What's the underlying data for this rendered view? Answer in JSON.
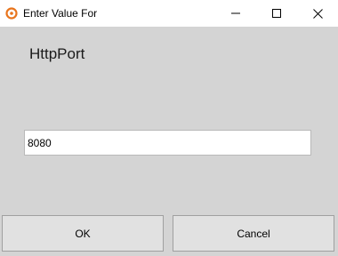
{
  "window": {
    "title": "Enter Value For",
    "icon": "orange-ring-icon",
    "controls": [
      "minimize-icon",
      "maximize-icon",
      "close-icon"
    ]
  },
  "form": {
    "label": "HttpPort",
    "input_value": "8080"
  },
  "buttons": {
    "ok_label": "OK",
    "cancel_label": "Cancel"
  },
  "colors": {
    "background": "#d4d4d4",
    "titlebar": "#ffffff",
    "accent": "#e8741c",
    "button_face": "#e1e1e1"
  }
}
